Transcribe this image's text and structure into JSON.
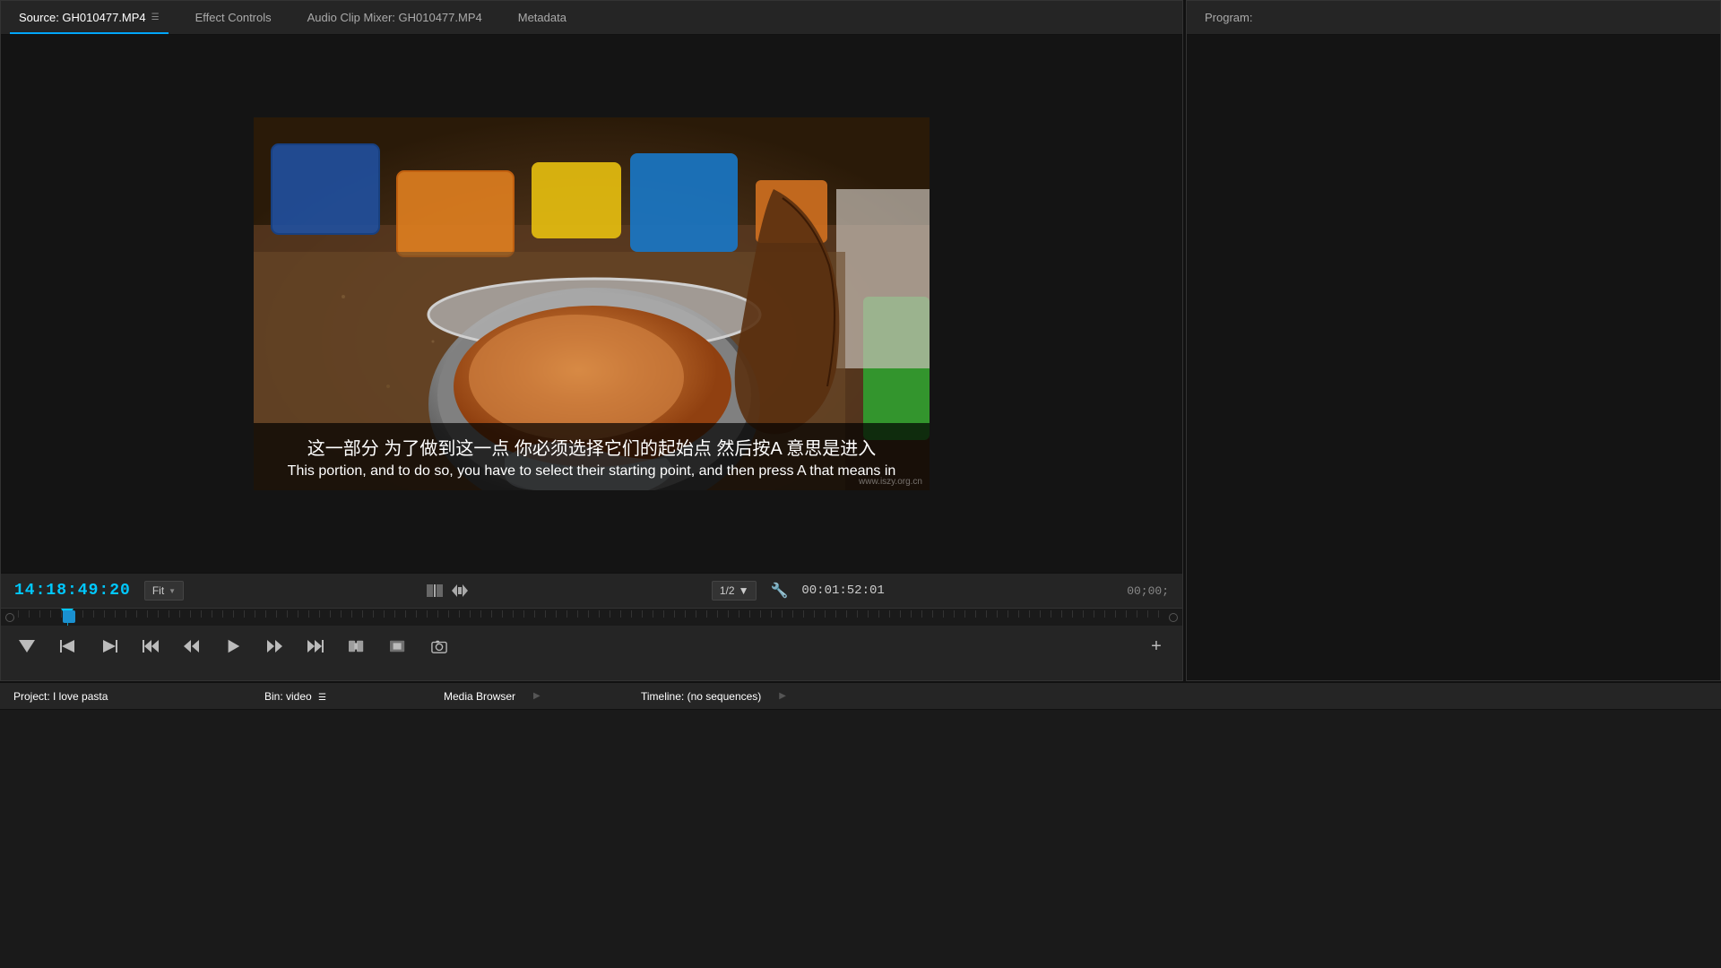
{
  "tabs": {
    "source": {
      "label": "Source: GH010477.MP4",
      "menu_icon": "☰"
    },
    "effect_controls": {
      "label": "Effect Controls"
    },
    "audio_clip_mixer": {
      "label": "Audio Clip Mixer: GH010477.MP4"
    },
    "metadata": {
      "label": "Metadata"
    },
    "program": {
      "label": "Program: "
    }
  },
  "player": {
    "timecode": "14:18:49:20",
    "fit_label": "Fit",
    "resolution": "1/2",
    "duration": "00:01:52:01",
    "program_timecode": "00;00;"
  },
  "subtitles": {
    "chinese": "这一部分 为了做到这一点 你必须选择它们的起始点 然后按A 意思是进入",
    "english": "This portion, and to do so, you have to select their starting point, and then press A that means in"
  },
  "bottom_tabs": {
    "project": "Project: I love pasta",
    "bin_video": "Bin: video",
    "media_browser": "Media Browser",
    "timeline": "Timeline: (no sequences)"
  },
  "watermark": "www.iszy.org.cn",
  "transport_buttons": {
    "mark_in": "▼",
    "mark_out": "|",
    "add_marker": "♦",
    "go_to_in": "◄|",
    "step_back": "◄◄",
    "play": "►",
    "step_forward": "►►",
    "go_to_out": "|►",
    "insert": "⊞",
    "overwrite": "⊟",
    "export": "📷",
    "add": "+"
  },
  "colors": {
    "accent_blue": "#00c8ff",
    "background_dark": "#1a1a1a",
    "panel_bg": "#1e1e1e",
    "tab_bg": "#252525",
    "active_tab_underline": "#00a6ff"
  }
}
